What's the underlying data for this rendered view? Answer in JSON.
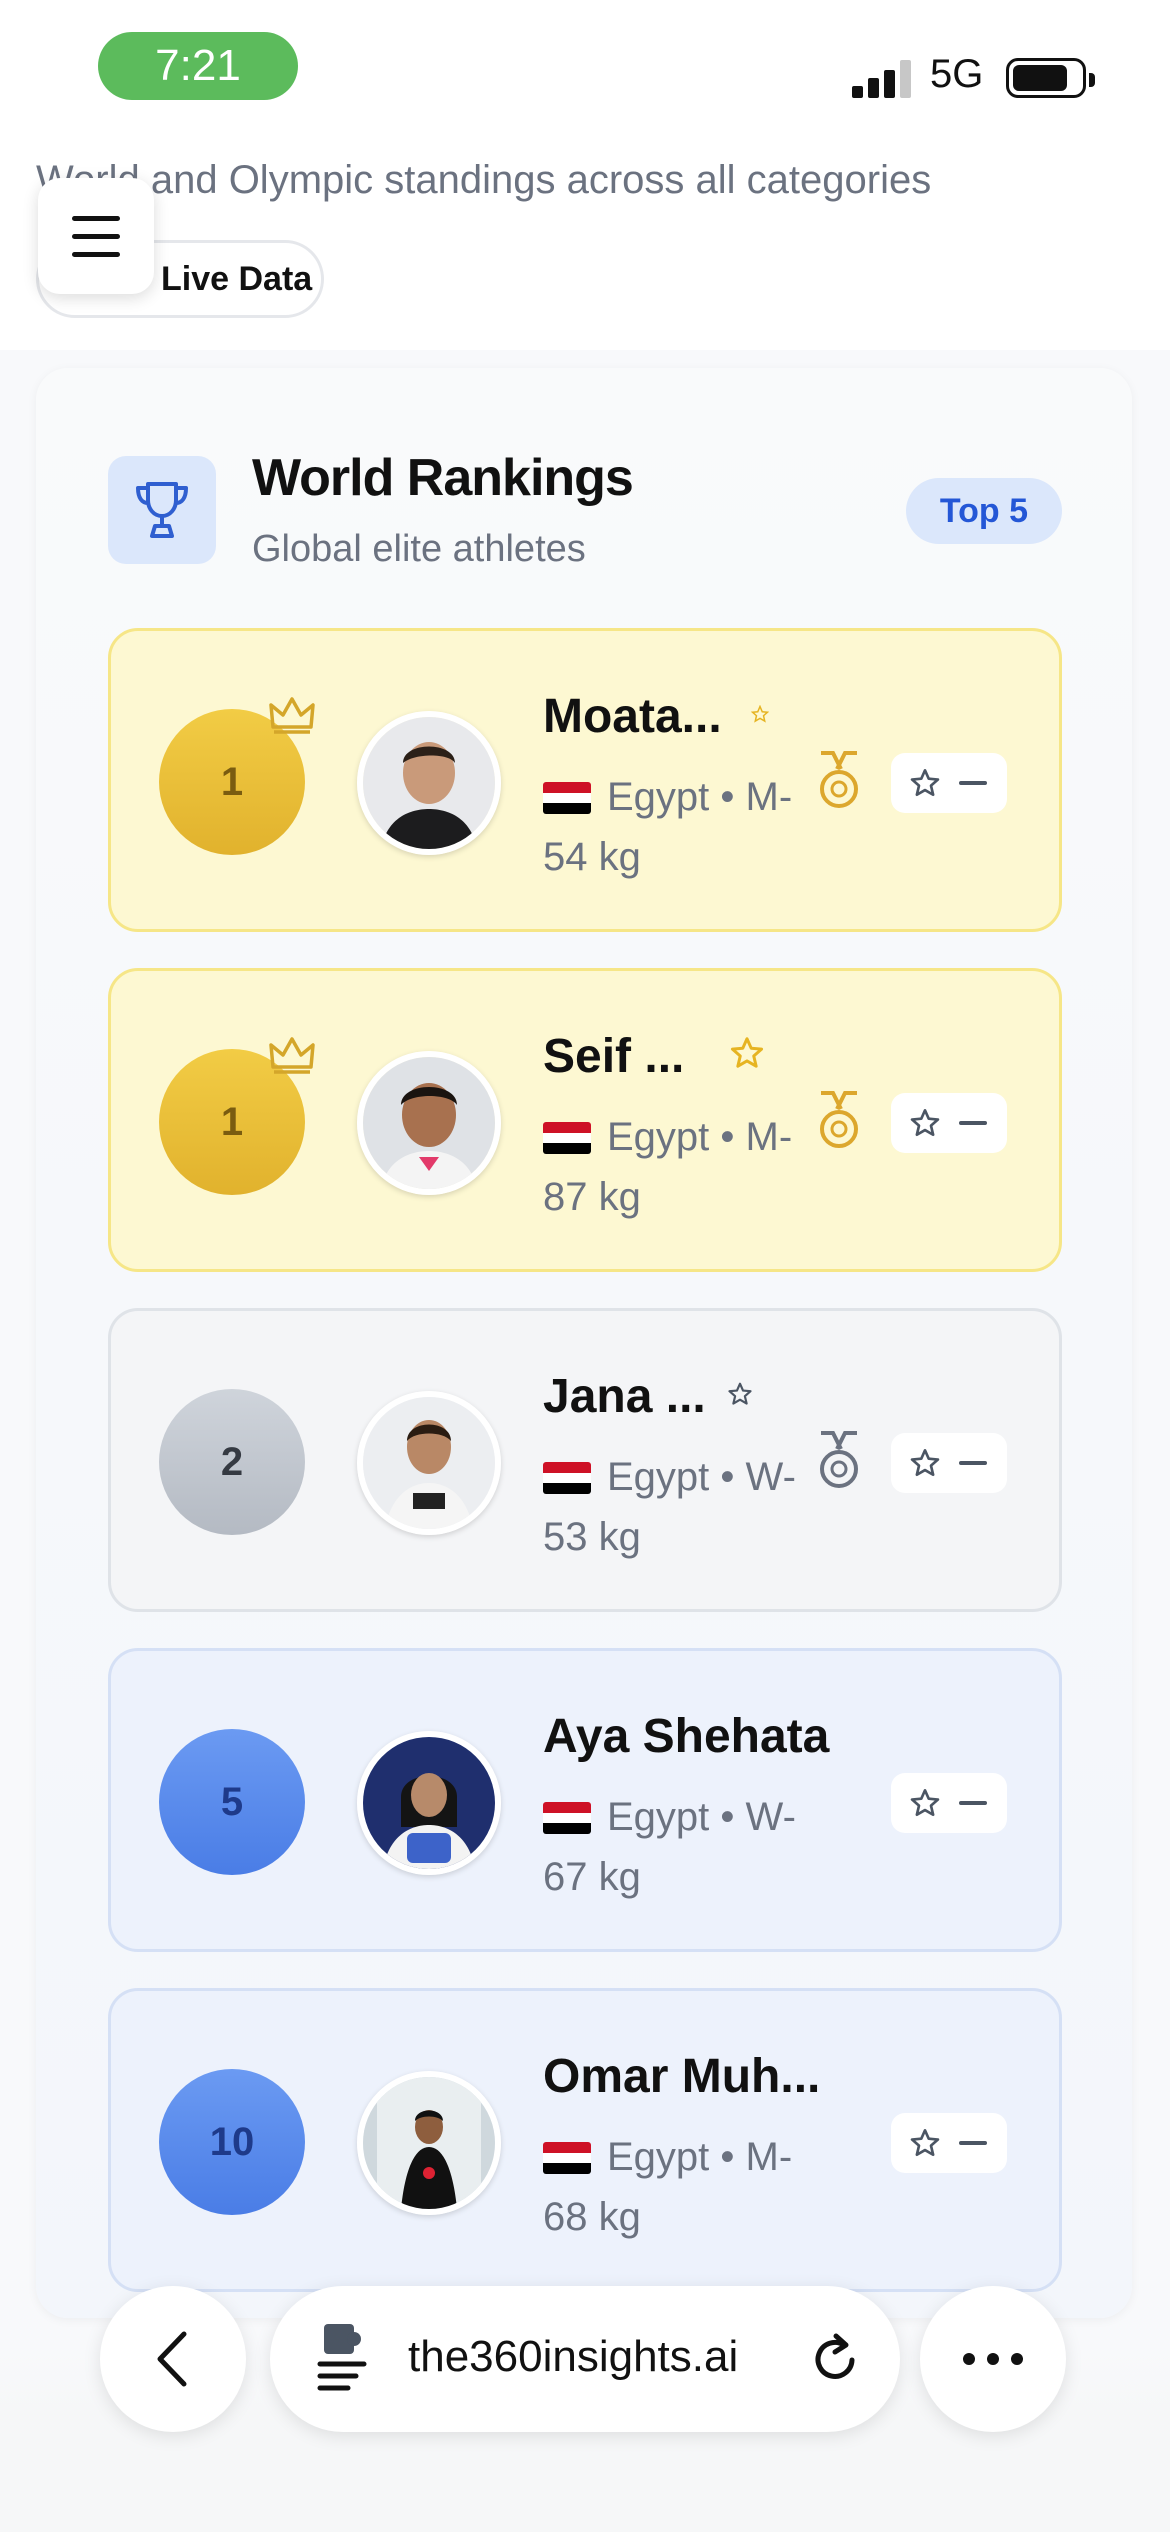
{
  "status_bar": {
    "time": "7:21",
    "network": "5G"
  },
  "header": {
    "subtitle": "World and Olympic standings across all categories",
    "live_button": "Live Data"
  },
  "card": {
    "title": "World Rankings",
    "subtitle": "Global elite athletes",
    "badge": "Top 5",
    "icon": "trophy-icon"
  },
  "athletes": [
    {
      "rank": "1",
      "name": "Moata...",
      "country": "Egypt",
      "category": "M-54 kg",
      "medal": "gold"
    },
    {
      "rank": "1",
      "name": "Seif ...",
      "country": "Egypt",
      "category": "M-87 kg",
      "medal": "gold"
    },
    {
      "rank": "2",
      "name": "Jana ...",
      "country": "Egypt",
      "category": "W-53 kg",
      "medal": "silver"
    },
    {
      "rank": "5",
      "name": "Aya Shehata",
      "country": "Egypt",
      "category": "W-67 kg",
      "medal": "none"
    },
    {
      "rank": "10",
      "name": "Omar Muh...",
      "country": "Egypt",
      "category": "M-68 kg",
      "medal": "none"
    }
  ],
  "colors": {
    "gold_row": "#fdf8d2",
    "silver_row": "#f4f5f7",
    "blue_row": "#edf2fc",
    "accent_blue": "#2457d6"
  },
  "browser": {
    "url": "the360insights.ai",
    "back_icon": "chevron-left-icon",
    "more_icon": "ellipsis-icon"
  }
}
